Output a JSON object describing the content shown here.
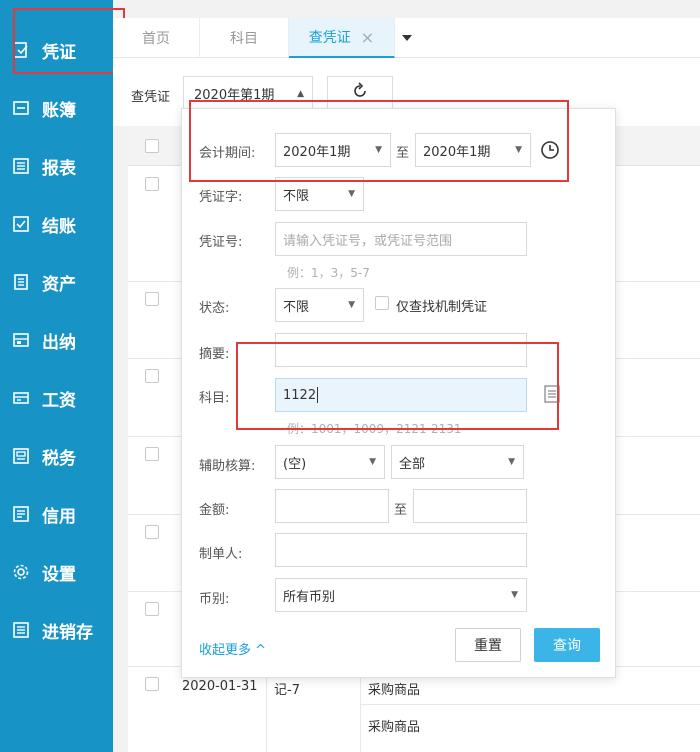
{
  "sidebar": {
    "items": [
      {
        "label": "凭证",
        "icon": "voucher-icon"
      },
      {
        "label": "账簿",
        "icon": "ledger-icon"
      },
      {
        "label": "报表",
        "icon": "report-icon"
      },
      {
        "label": "结账",
        "icon": "checkout-icon"
      },
      {
        "label": "资产",
        "icon": "asset-icon"
      },
      {
        "label": "出纳",
        "icon": "cashier-icon"
      },
      {
        "label": "工资",
        "icon": "salary-icon"
      },
      {
        "label": "税务",
        "icon": "tax-icon"
      },
      {
        "label": "信用",
        "icon": "credit-icon"
      },
      {
        "label": "设置",
        "icon": "gear-icon"
      },
      {
        "label": "进销存",
        "icon": "inventory-icon"
      }
    ]
  },
  "tabs": {
    "home": "首页",
    "subject": "科目",
    "voucher_query": "查凭证",
    "close_glyph": "×"
  },
  "toolbar": {
    "label": "查凭证",
    "period_value": "2020年第1期"
  },
  "table": {
    "rows": [
      {
        "date": "2020-01-31",
        "voucher_no": "记-7",
        "summary1": "采购商品",
        "summary2": "采购商品"
      }
    ]
  },
  "popup": {
    "period_label": "会计期间:",
    "period_from": "2020年1期",
    "period_to_sep": "至",
    "period_to": "2020年1期",
    "voucher_word_label": "凭证字:",
    "voucher_word_value": "不限",
    "voucher_no_label": "凭证号:",
    "voucher_no_placeholder": "请输入凭证号，或凭证号范围",
    "voucher_no_hint": "例：1，3，5-7",
    "status_label": "状态:",
    "status_value": "不限",
    "only_machine_label": "仅查找机制凭证",
    "summary_label": "摘要:",
    "summary_value": "",
    "subject_label": "科目:",
    "subject_value": "1122",
    "subject_hint": "例：1001，1009，2121-2131",
    "aux_label": "辅助核算:",
    "aux_value1": "(空)",
    "aux_value2": "全部",
    "amount_label": "金额:",
    "amount_to_sep": "至",
    "maker_label": "制单人:",
    "currency_label": "币别:",
    "currency_value": "所有币别",
    "collapse_label": "收起更多",
    "reset_label": "重置",
    "query_label": "查询"
  },
  "colors": {
    "sidebar_bg": "#1793c6",
    "accent": "#1aa0d8",
    "query_btn": "#3bb4e8",
    "highlight_box": "#e03a3a"
  }
}
